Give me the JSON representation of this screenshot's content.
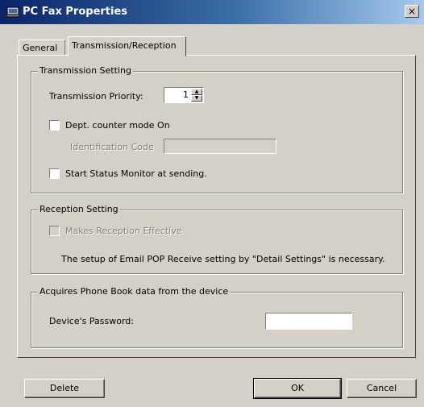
{
  "window": {
    "title": "PC Fax Properties",
    "close_label": "×"
  },
  "tabs": [
    {
      "label": "General",
      "selected": false
    },
    {
      "label": "Transmission/Reception",
      "selected": true
    }
  ],
  "transmission": {
    "group_title": "Transmission Setting",
    "priority_label": "Transmission Priority:",
    "priority_value": "1",
    "dept_counter_label": "Dept. counter mode On",
    "dept_counter_checked": false,
    "id_code_label": "Identification Code",
    "id_code_value": "",
    "status_monitor_label": "Start Status Monitor at sending.",
    "status_monitor_checked": false
  },
  "reception": {
    "group_title": "Reception Setting",
    "effective_label": "Makes Reception Effective",
    "effective_checked": false,
    "note": "The setup of Email POP Receive setting by \"Detail Settings\" is necessary."
  },
  "phonebook": {
    "group_title": "Acquires Phone Book data from the device",
    "password_label": "Device's Password:",
    "password_value": ""
  },
  "buttons": {
    "delete": "Delete",
    "ok": "OK",
    "cancel": "Cancel"
  },
  "colors": {
    "face": "#d4d0c8",
    "title_start": "#0a246a",
    "title_end": "#a6caf0",
    "disabled_text": "#808080"
  }
}
